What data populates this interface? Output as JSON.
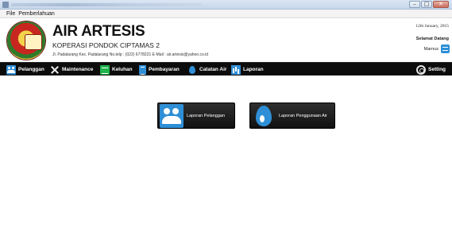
{
  "menubar": {
    "items": [
      "File",
      "Pemberlahuan"
    ]
  },
  "header": {
    "title": "AIR ARTESIS",
    "subtitle": "KOPERASI PONDOK CIPTAMAS 2",
    "address": "Jl. Padalarang Kec. Padalarang No.telp : (022) 6778221 E-Mail : air.artesis@yahoo.co.id",
    "date": "12th January, 2015",
    "welcome": "Selamat Datang",
    "user": "Marnus"
  },
  "toolbar": {
    "items": [
      {
        "label": "Pelanggan",
        "icon": "users-icon"
      },
      {
        "label": "Maintenance",
        "icon": "tools-icon"
      },
      {
        "label": "Keluhan",
        "icon": "complaint-icon"
      },
      {
        "label": "Pembayaran",
        "icon": "payment-icon"
      },
      {
        "label": "Catatan Air",
        "icon": "water-drop-icon"
      },
      {
        "label": "Laporan",
        "icon": "chart-icon"
      },
      {
        "label": "Setting",
        "icon": "gear-icon"
      }
    ]
  },
  "content": {
    "buttons": [
      {
        "label": "Laporan Pelanggan",
        "icon": "users-icon"
      },
      {
        "label": "Laporan Penggunaan Air",
        "icon": "water-drop-icon"
      }
    ]
  },
  "colors": {
    "accent": "#2f8fd6",
    "toolbar_bg": "#0c0c0c",
    "green": "#1fb34c"
  }
}
